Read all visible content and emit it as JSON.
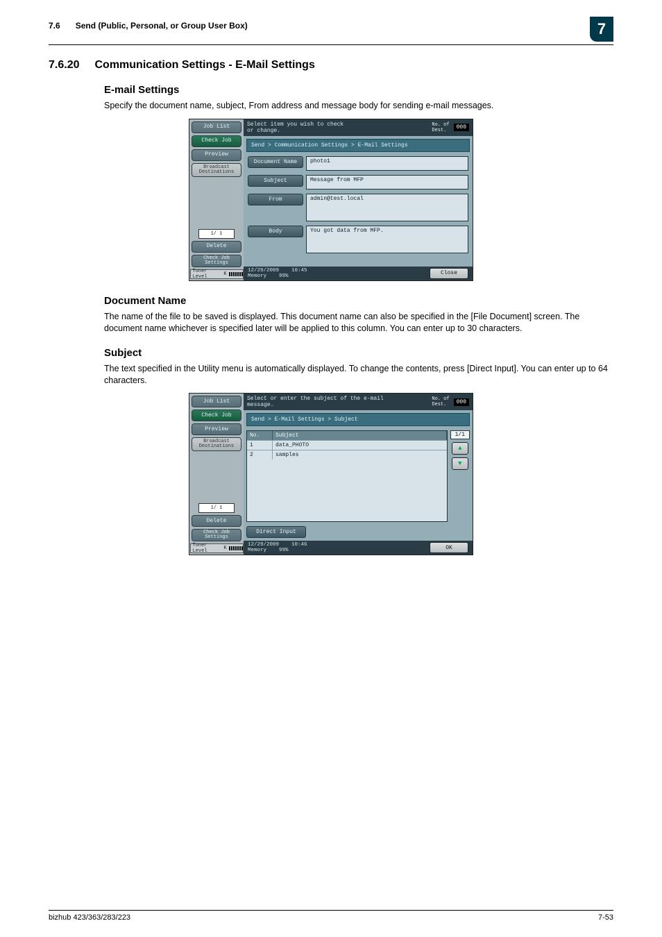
{
  "header": {
    "section_no": "7.6",
    "section_title": "Send (Public, Personal, or Group User Box)",
    "chapter_no": "7"
  },
  "h_num": "7.6.20",
  "h_title": "Communication Settings - E-Mail Settings",
  "h_sub1": "E-mail Settings",
  "p_sub1": "Specify the document name, subject, From address and message body for sending e-mail messages.",
  "h_sub2": "Document Name",
  "p_sub2": "The name of the file to be saved is displayed. This document name can also be specified in the [File Document] screen. The document name whichever is specified later will be applied to this column. You can enter up to 30 characters.",
  "h_sub3": "Subject",
  "p_sub3": "The text specified in the Utility menu is automatically displayed. To change the contents, press [Direct Input]. You can enter up to 64 characters.",
  "footer": {
    "model": "bizhub 423/363/283/223",
    "page": "7-53"
  },
  "ss_common": {
    "job_list": "Job List",
    "check_job": "Check Job",
    "preview": "Preview",
    "broadcast": "Broadcast\nDestinations",
    "pager": "1/  1",
    "delete": "Delete",
    "check_settings": "Check Job\nSettings",
    "toner": "Toner Level",
    "dest_label": "No. of\nDest.",
    "dest_count": "000",
    "date": "12/29/2009",
    "memory_label": "Memory",
    "memory_val": "99%"
  },
  "ss1": {
    "instruction": "Select item you wish to check\nor change.",
    "crumb": "Send > Communication Settings > E-Mail Settings",
    "f_doc": "Document Name",
    "v_doc": "photo1",
    "f_subject": "Subject",
    "v_subject": "Message from MFP",
    "f_from": "From",
    "v_from": "admin@test.local",
    "f_body": "Body",
    "v_body": "You got data from MFP.",
    "time": "10:45",
    "close": "Close"
  },
  "ss2": {
    "instruction": "Select or enter the subject of the e-mail\nmessage.",
    "crumb": "Send > E-Mail Settings > Subject",
    "col_no": "No.",
    "col_subject": "Subject",
    "rows": [
      {
        "no": "1",
        "subject": "data_PHOTO"
      },
      {
        "no": "2",
        "subject": "samples"
      }
    ],
    "page_ind": "1/1",
    "direct_input": "Direct Input",
    "time": "10:46",
    "ok": "OK"
  }
}
